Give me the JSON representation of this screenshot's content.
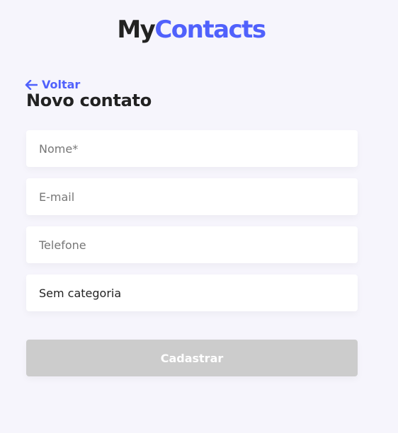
{
  "header": {
    "logo_part1": "My",
    "logo_part2": "Contacts"
  },
  "nav": {
    "back_label": "Voltar",
    "back_icon": "arrow-left-icon"
  },
  "page": {
    "title": "Novo contato"
  },
  "form": {
    "name": {
      "value": "",
      "placeholder": "Nome*"
    },
    "email": {
      "value": "",
      "placeholder": "E-mail"
    },
    "phone": {
      "value": "",
      "placeholder": "Telefone"
    },
    "category": {
      "selected": "Sem categoria"
    },
    "submit_label": "Cadastrar",
    "submit_disabled": true
  },
  "colors": {
    "accent": "#5061fc",
    "text": "#222222",
    "background": "#f6f5fc",
    "disabled_button": "#cccccc"
  }
}
